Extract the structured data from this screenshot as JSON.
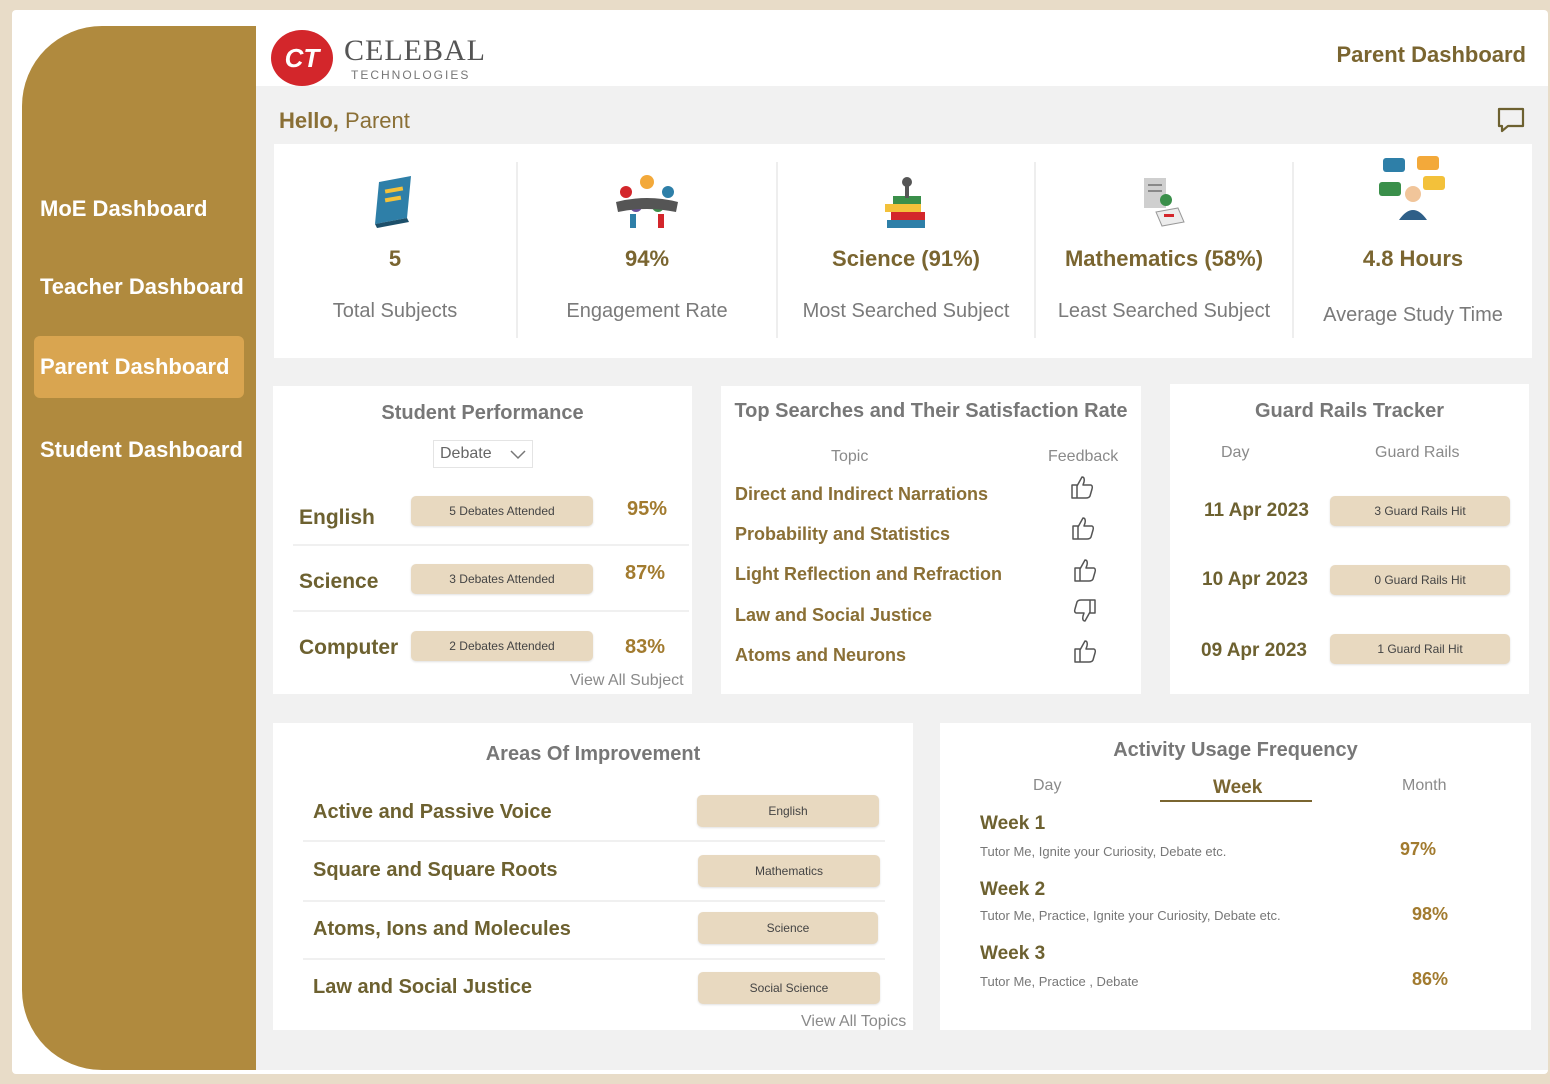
{
  "nav": {
    "items": [
      {
        "label": "MoE Dashboard"
      },
      {
        "label": "Teacher Dashboard"
      },
      {
        "label": "Parent Dashboard"
      },
      {
        "label": "Student Dashboard"
      }
    ]
  },
  "header": {
    "logo_mark": "CT",
    "logo_name": "CELEBAL",
    "logo_sub": "TECHNOLOGIES",
    "title": "Parent Dashboard"
  },
  "greeting": {
    "hello": "Hello,",
    "name": "Parent"
  },
  "kpis": [
    {
      "value": "5",
      "label": "Total Subjects",
      "icon": "book-icon"
    },
    {
      "value": "94%",
      "label": "Engagement Rate",
      "icon": "team-icon"
    },
    {
      "value": "Science (91%)",
      "label": "Most Searched Subject",
      "icon": "science-books-icon"
    },
    {
      "value": "Mathematics (58%)",
      "label": "Least Searched Subject",
      "icon": "math-study-icon"
    },
    {
      "value": "4.8 Hours",
      "label": "Average Study Time",
      "icon": "chat-user-icon"
    }
  ],
  "performance": {
    "title": "Student Performance",
    "dropdown": "Debate",
    "rows": [
      {
        "subject": "English",
        "badge": "5 Debates Attended",
        "pct": "95%"
      },
      {
        "subject": "Science",
        "badge": "3 Debates Attended",
        "pct": "87%"
      },
      {
        "subject": "Computer",
        "badge": "2 Debates Attended",
        "pct": "83%"
      }
    ],
    "link": "View All Subject"
  },
  "searches": {
    "title": "Top Searches and Their Satisfaction Rate",
    "col_topic": "Topic",
    "col_feedback": "Feedback",
    "rows": [
      {
        "topic": "Direct and Indirect Narrations",
        "feedback": "thumbs-up"
      },
      {
        "topic": "Probability and Statistics",
        "feedback": "thumbs-up"
      },
      {
        "topic": "Light Reflection and Refraction",
        "feedback": "thumbs-up"
      },
      {
        "topic": "Law and Social Justice",
        "feedback": "thumbs-down"
      },
      {
        "topic": "Atoms and Neurons",
        "feedback": "thumbs-up"
      }
    ]
  },
  "guard": {
    "title": "Guard Rails Tracker",
    "col_day": "Day",
    "col_rails": "Guard Rails",
    "rows": [
      {
        "date": "11 Apr 2023",
        "badge": "3 Guard Rails Hit"
      },
      {
        "date": "10 Apr 2023",
        "badge": "0 Guard Rails Hit"
      },
      {
        "date": "09 Apr 2023",
        "badge": "1 Guard Rail Hit"
      }
    ]
  },
  "improvement": {
    "title": "Areas Of Improvement",
    "rows": [
      {
        "topic": "Active and Passive Voice",
        "subject": "English"
      },
      {
        "topic": "Square and Square Roots",
        "subject": "Mathematics"
      },
      {
        "topic": "Atoms, Ions and Molecules",
        "subject": "Science"
      },
      {
        "topic": "Law and Social Justice",
        "subject": "Social Science"
      }
    ],
    "link": "View All Topics"
  },
  "activity": {
    "title": "Activity Usage Frequency",
    "tabs": {
      "day": "Day",
      "week": "Week",
      "month": "Month"
    },
    "rows": [
      {
        "week": "Week 1",
        "activities": "Tutor Me, Ignite your Curiosity, Debate etc.",
        "pct": "97%"
      },
      {
        "week": "Week 2",
        "activities": "Tutor Me, Practice, Ignite your Curiosity, Debate etc.",
        "pct": "98%"
      },
      {
        "week": "Week 3",
        "activities": "Tutor Me, Practice , Debate",
        "pct": "86%"
      }
    ]
  },
  "colors": {
    "sidebar": "#b08a3e",
    "active_nav": "#d9a550",
    "accent_text": "#7a6530",
    "pill": "#e8d9c0",
    "logo_red": "#d3262b"
  }
}
